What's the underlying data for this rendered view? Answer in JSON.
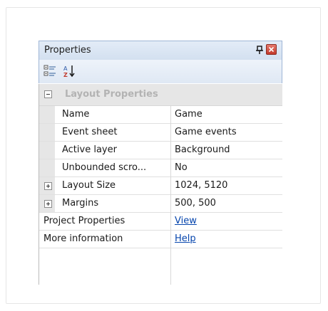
{
  "panel": {
    "title": "Properties"
  },
  "toolbar": {
    "categorized_icon": "categorized-icon",
    "alphabetical_icon": "sort-alpha-icon"
  },
  "category": {
    "label": "Layout Properties"
  },
  "rows": [
    {
      "name": "Name",
      "value": "Game"
    },
    {
      "name": "Event sheet",
      "value": "Game events"
    },
    {
      "name": "Active layer",
      "value": "Background"
    },
    {
      "name": "Unbounded scro...",
      "value": "No"
    },
    {
      "name": "Layout Size",
      "value": "1024, 5120"
    },
    {
      "name": "Margins",
      "value": "500, 500"
    }
  ],
  "links": [
    {
      "name": "Project Properties",
      "value": "View"
    },
    {
      "name": "More information",
      "value": "Help"
    }
  ],
  "colors": {
    "header_bg": "#d3e0f0",
    "category_bg": "#e6e6e6",
    "link": "#0645ad",
    "close_button": "#c2392b"
  }
}
